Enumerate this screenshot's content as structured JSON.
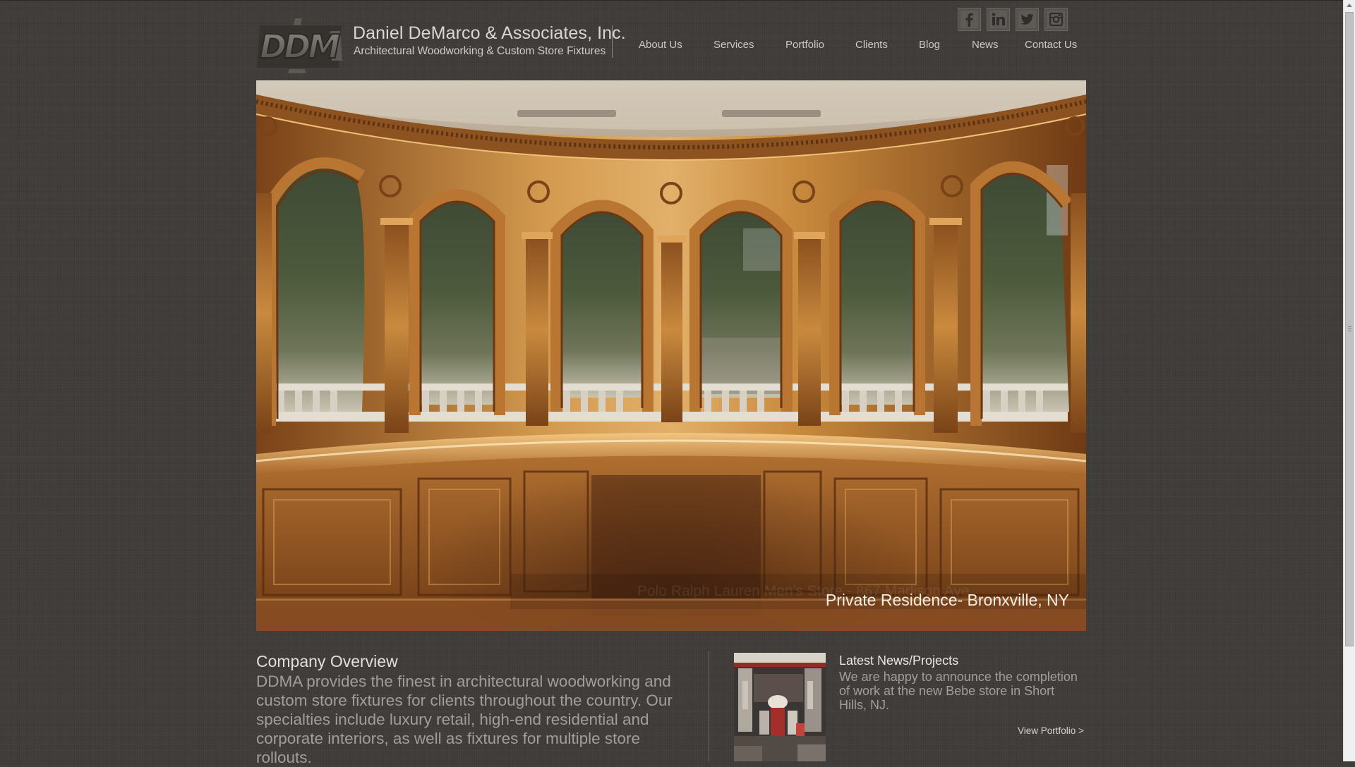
{
  "brand": {
    "name": "Daniel DeMarco & Associates, Inc.",
    "tagline": "Architectural Woodworking & Custom Store Fixtures",
    "logo_icon": "ddm-logo-icon"
  },
  "nav": {
    "items": [
      "About Us",
      "Services",
      "Portfolio",
      "Clients",
      "Blog",
      "News",
      "Contact Us"
    ]
  },
  "social": {
    "icons": [
      "facebook-icon",
      "linkedin-icon",
      "twitter-icon",
      "instagram-icon"
    ]
  },
  "hero": {
    "caption": "Private Residence- Bronxville, NY",
    "ghost_caption": "Polo Ralph Lauren Men's Store - 867 Madison Ave"
  },
  "overview": {
    "title": "Company Overview",
    "body": "DDMA provides the finest in architectural woodworking and custom store fixtures for clients throughout the country. Our specialties include luxury retail, high-end residential and corporate interiors, as well as fixtures for multiple store rollouts."
  },
  "news": {
    "title": "Latest News/Projects",
    "body": "We are happy to announce the completion of work at the new Bebe store in Short Hills, NJ.",
    "link": "View Portfolio >"
  },
  "colors": {
    "background": "#403d3a",
    "wood": "#b5782f",
    "text_light": "#d9d6d2",
    "text_muted": "#a19d98"
  }
}
